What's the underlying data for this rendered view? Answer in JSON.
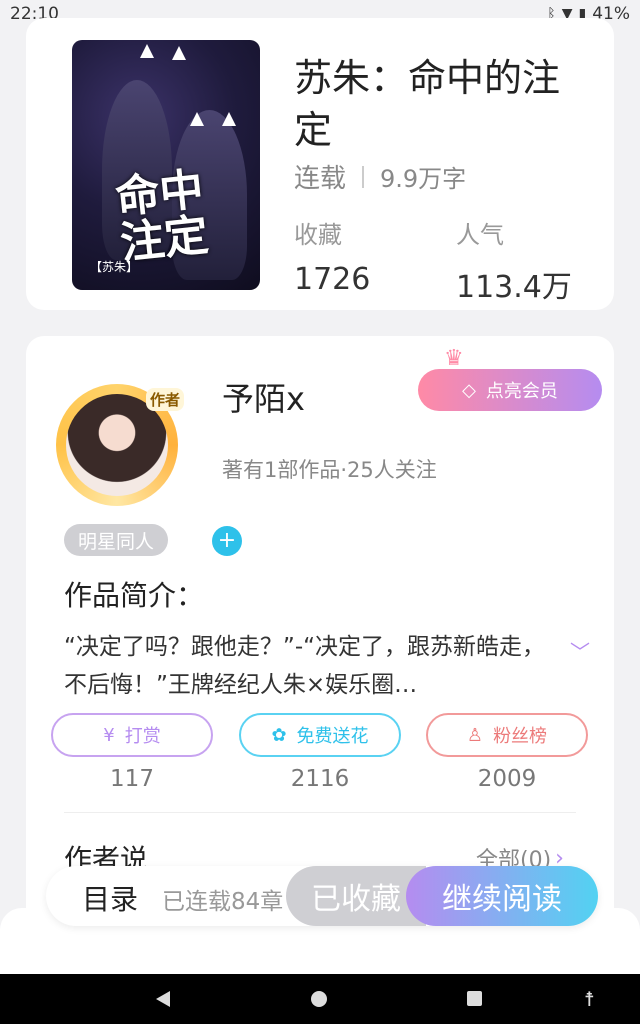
{
  "status_bar": {
    "time": "22:10",
    "battery": "41%"
  },
  "book": {
    "cover_title": "命中注定",
    "cover_sub": "【苏朱】",
    "title": "苏朱：命中的注定",
    "status": "连载",
    "word_count": "9.9万字",
    "stats": [
      {
        "label": "收藏",
        "value": "1726"
      },
      {
        "label": "人气",
        "value": "113.4万"
      }
    ]
  },
  "author": {
    "badge": "作者",
    "name": "予陌x",
    "vip_label": "点亮会员",
    "meta": "著有1部作品·25人关注",
    "tag": "明星同人",
    "tag_add": "+"
  },
  "intro": {
    "heading": "作品简介：",
    "text": "“决定了吗？跟他走？”-“决定了，跟苏新皓走，不后悔！”王牌经纪人朱×娱乐圈…"
  },
  "actions": [
    {
      "label": "打赏",
      "icon": "coin-icon",
      "count": "117"
    },
    {
      "label": "免费送花",
      "icon": "flower-icon",
      "count": "2116"
    },
    {
      "label": "粉丝榜",
      "icon": "person-icon",
      "count": "2009"
    }
  ],
  "author_says": {
    "heading": "作者说",
    "link": "全部(0)"
  },
  "bottom_bar": {
    "toc": "目录",
    "progress": "已连载84章",
    "collected": "已收藏",
    "continue": "继续阅读"
  },
  "colors": {
    "accent_purple": "#b58cf0",
    "accent_cyan": "#2ec1ea",
    "accent_pink": "#ff8aa6"
  }
}
